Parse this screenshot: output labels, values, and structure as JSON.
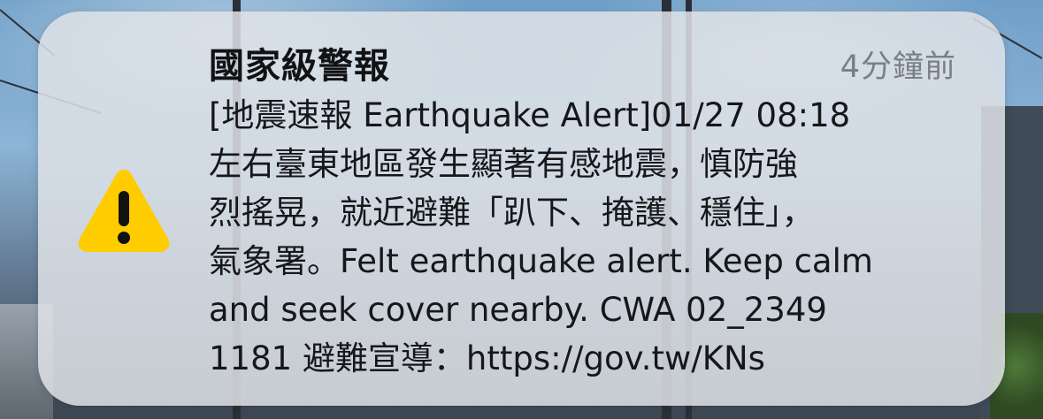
{
  "notification": {
    "title": "國家級警報",
    "time": "4分鐘前",
    "icon": "warning-triangle-icon",
    "accent_color": "#FFCC00",
    "body_lines": [
      "[地震速報 Earthquake Alert]01/27 08:18",
      "左右臺東地區發生顯著有感地震，慎防強",
      "烈搖晃，就近避難「趴下、掩護、穩住」，",
      "氣象署。Felt earthquake alert. Keep calm",
      "and seek cover nearby. CWA 02_2349",
      "1181 避難宣導：https://gov.tw/KNs"
    ]
  }
}
